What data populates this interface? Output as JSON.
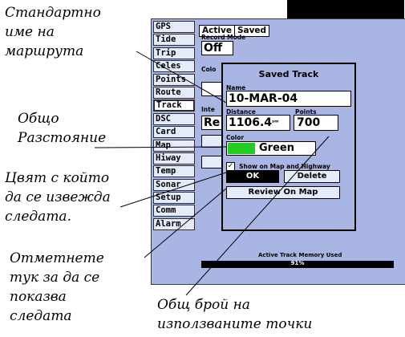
{
  "menu": [
    {
      "label": "GPS"
    },
    {
      "label": "Tide"
    },
    {
      "label": "Trip"
    },
    {
      "label": "Celes"
    },
    {
      "label": "Points"
    },
    {
      "label": "Route"
    },
    {
      "label": "Track"
    },
    {
      "label": "DSC"
    },
    {
      "label": "Card"
    },
    {
      "label": "Map"
    },
    {
      "label": "Hiway"
    },
    {
      "label": "Temp"
    },
    {
      "label": "Sonar"
    },
    {
      "label": "Setup"
    },
    {
      "label": "Comm"
    },
    {
      "label": "Alarm"
    }
  ],
  "selected_menu": "Track",
  "tabs": {
    "active": "Active",
    "saved": "Saved"
  },
  "active_panel": {
    "record_mode_label": "Record Mode",
    "record_mode_value": "Off",
    "color_label": "Colo",
    "interval_label": "Inte",
    "interval_value": "Re"
  },
  "popup": {
    "title": "Saved Track",
    "name_label": "Name",
    "name_value": "10-MAR-04",
    "distance_label": "Distance",
    "distance_value": "1106.4",
    "distance_unit": "ˢᵐ",
    "points_label": "Points",
    "points_value": "700",
    "color_label": "Color",
    "color_value": "Green",
    "color_hex": "#22cc22",
    "show_on_map_label": "Show on Map and Highway",
    "show_on_map_checked": true,
    "ok_label": "OK",
    "delete_label": "Delete",
    "review_label": "Review On Map"
  },
  "memory": {
    "label": "Active Track Memory Used",
    "value": "91%"
  },
  "annotations": {
    "track_name": [
      "Стандартно",
      "име на",
      "маршрута"
    ],
    "total_distance": [
      "Общо",
      "Разстояние"
    ],
    "track_color": [
      "Цвят с който",
      "да се извежда",
      "следата."
    ],
    "show_checkbox": [
      "Отметнете",
      "тук за да се",
      "показва",
      "следата"
    ],
    "total_points": [
      "Общ брой на",
      "използваните точки"
    ]
  }
}
